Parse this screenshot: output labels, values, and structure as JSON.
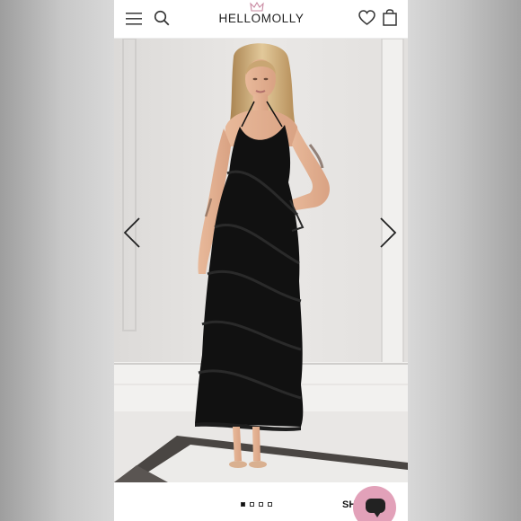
{
  "header": {
    "brand": "HELLOMOLLY",
    "icons": [
      "menu-icon",
      "search-icon",
      "heart-icon",
      "bag-icon"
    ]
  },
  "gallery": {
    "slide_count": 4,
    "active_slide": 1,
    "prev_icon": "chevron-left-icon",
    "next_icon": "chevron-right-icon"
  },
  "footer": {
    "shop_label": "SH",
    "chat_icon": "chat-icon"
  },
  "colors": {
    "chat_accent": "#e2a1b9",
    "dress": "#111111",
    "wall": "#e7e5e3"
  }
}
